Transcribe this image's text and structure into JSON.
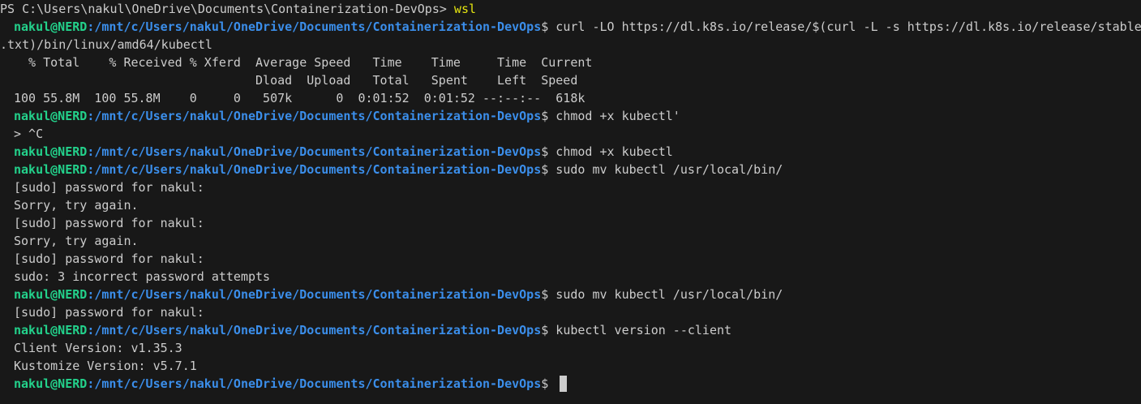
{
  "terminal": {
    "ps_prompt": "PS C:\\Users\\nakul\\OneDrive\\Documents\\Containerization-DevOps> ",
    "ps_command": "wsl",
    "user_host": "nakul@NERD",
    "path": ":/mnt/c/Users/nakul/OneDrive/Documents/Containerization-DevOps",
    "prompt_suffix": "$ ",
    "curl_command": "curl -LO https://dl.k8s.io/release/$(curl -L -s https://dl.k8s.io/release/stable",
    "curl_wrap": ".txt)/bin/linux/amd64/kubectl",
    "curl_header_1": "  % Total    % Received % Xferd  Average Speed   Time    Time     Time  Current",
    "curl_header_2": "                                 Dload  Upload   Total   Spent    Left  Speed",
    "curl_progress": "100 55.8M  100 55.8M    0     0   507k      0  0:01:52  0:01:52 --:--:--  618k",
    "cmd_chmod_quote": "chmod +x kubectl'",
    "continuation": "> ^C",
    "cmd_chmod": "chmod +x kubectl",
    "cmd_mv": "sudo mv kubectl /usr/local/bin/",
    "sudo_prompt": "[sudo] password for nakul:",
    "sorry": "Sorry, try again.",
    "sudo_fail": "sudo: 3 incorrect password attempts",
    "cmd_version": "kubectl version --client",
    "client_version": "Client Version: v1.35.3",
    "kustomize_version": "Kustomize Version: v5.7.1"
  },
  "colors": {
    "background": "#181818",
    "foreground": "#cccccc",
    "user_green": "#23d18b",
    "path_blue": "#3b8eea",
    "command_yellow": "#e5e510"
  }
}
